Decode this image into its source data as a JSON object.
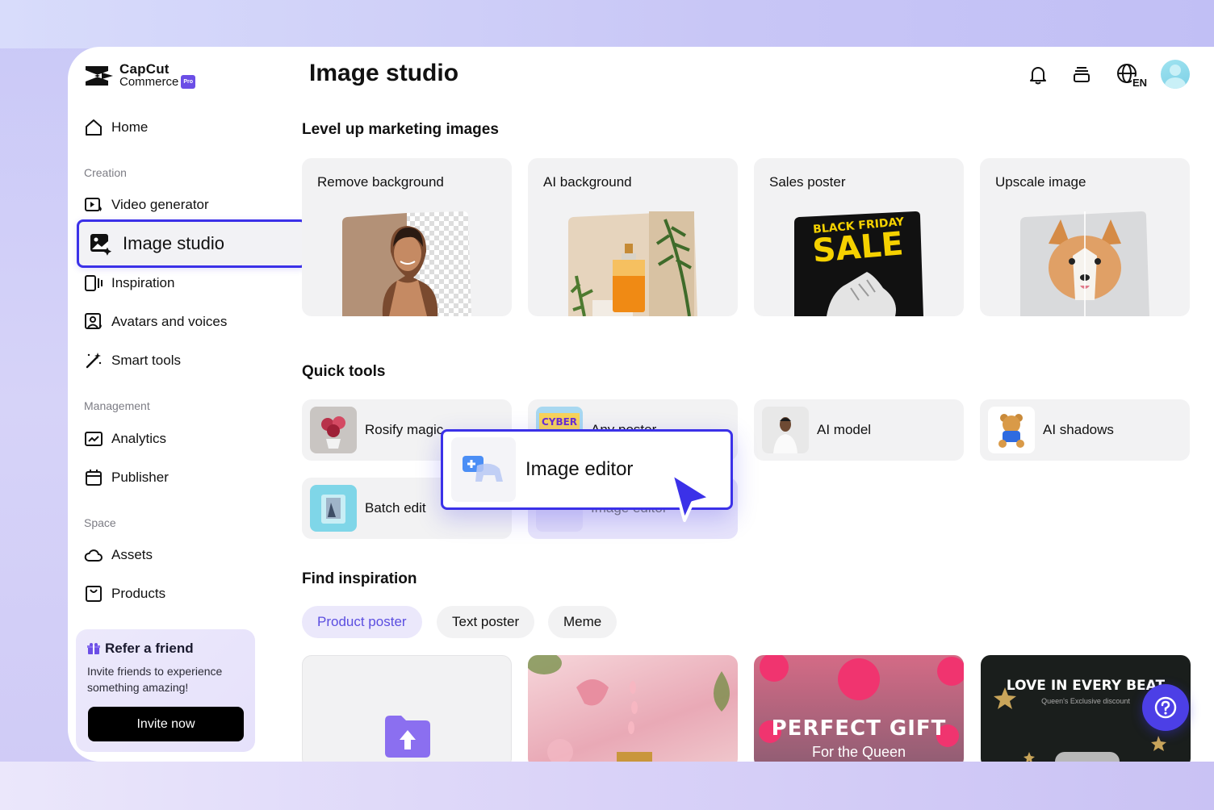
{
  "brand": {
    "name": "CapCut",
    "sub": "Commerce",
    "badge": "Pro"
  },
  "header": {
    "title": "Image studio",
    "lang": "EN"
  },
  "sidebar": {
    "home": "Home",
    "creation_label": "Creation",
    "creation": [
      "Video generator",
      "Image studio",
      "Inspiration",
      "Avatars and voices",
      "Smart tools"
    ],
    "management_label": "Management",
    "management": [
      "Analytics",
      "Publisher"
    ],
    "space_label": "Space",
    "space": [
      "Assets",
      "Products"
    ]
  },
  "refer": {
    "title": "Refer a friend",
    "desc": "Invite friends to experience something amazing!",
    "button": "Invite now"
  },
  "sections": {
    "level_up": "Level up marketing images",
    "quick_tools": "Quick tools",
    "find_inspiration": "Find inspiration"
  },
  "feature_cards": [
    "Remove background",
    "AI background",
    "Sales poster",
    "Upscale image"
  ],
  "sales_poster_text": {
    "line1": "BLACK FRIDAY",
    "line2": "SALE"
  },
  "quick_tools": [
    "Rosify magic",
    "Any poster",
    "AI model",
    "AI shadows",
    "Batch edit",
    "Image editor"
  ],
  "cyber_text": "CYBER",
  "popup": {
    "label": "Image editor"
  },
  "inspiration_tabs": [
    "Product poster",
    "Text poster",
    "Meme"
  ],
  "inspiration_cards": {
    "gift": {
      "title": "PERFECT GIFT",
      "sub": "For the Queen"
    },
    "love": {
      "title": "LOVE IN EVERY BEAT",
      "sub": "Queen's Exclusive discount"
    }
  },
  "colors": {
    "accent": "#3b31e8",
    "help": "#4c3fe6"
  }
}
